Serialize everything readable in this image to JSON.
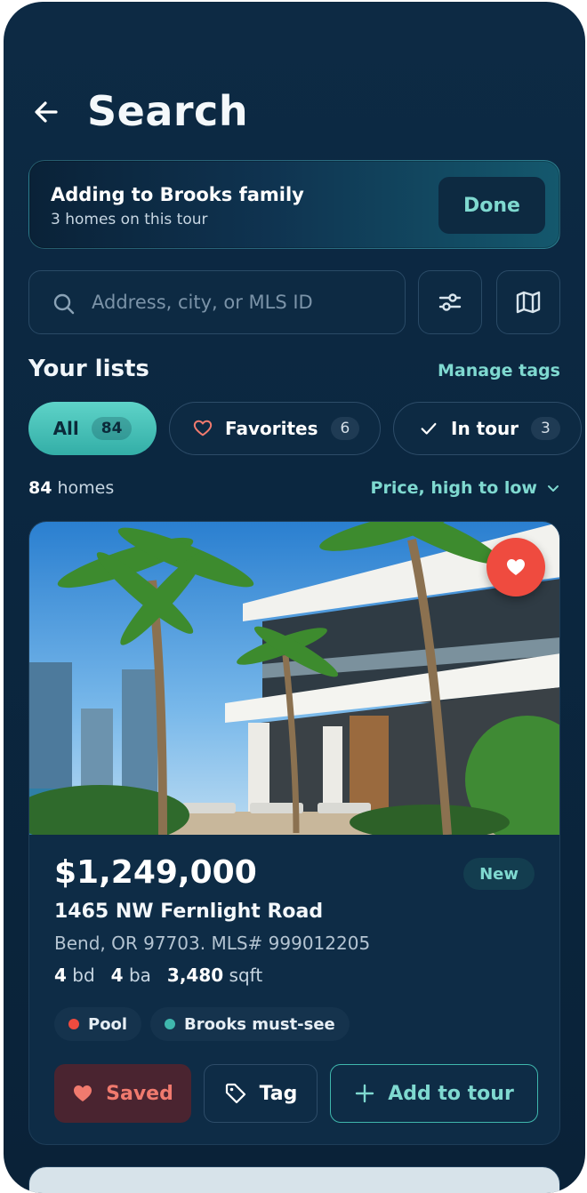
{
  "header": {
    "title": "Search",
    "back_icon": "arrow-left-icon"
  },
  "tour_banner": {
    "title": "Adding to Brooks family",
    "subtitle": "3 homes on this tour",
    "done_label": "Done"
  },
  "search": {
    "placeholder": "Address, city, or MLS ID",
    "value": "",
    "search_icon": "search-icon",
    "filter_icon": "sliders-icon",
    "map_icon": "map-icon"
  },
  "lists": {
    "title": "Your lists",
    "manage_label": "Manage tags",
    "chips": [
      {
        "label": "All",
        "count": "84",
        "selected": true
      },
      {
        "label": "Favorites",
        "count": "6",
        "icon": "heart-outline-icon"
      },
      {
        "label": "In tour",
        "count": "3",
        "icon": "check-icon"
      }
    ]
  },
  "results": {
    "count_number": "84",
    "count_label": "homes",
    "sort_label": "Price, high to low"
  },
  "listing": {
    "price": "$1,249,000",
    "badge": "New",
    "address": "1465 NW Fernlight Road",
    "city_mls": "Bend, OR 97703. MLS# 999012205",
    "beds": "4",
    "beds_label": "bd",
    "baths": "4",
    "baths_label": "ba",
    "sqft": "3,480",
    "sqft_label": "sqft",
    "tags": [
      {
        "label": "Pool",
        "color": "#ef4b3f"
      },
      {
        "label": "Brooks must-see",
        "color": "#3fb7ad"
      }
    ],
    "actions": {
      "saved_label": "Saved",
      "tag_label": "Tag",
      "add_label": "Add to tour"
    },
    "favorited": true
  },
  "colors": {
    "accent": "#7fd9d0",
    "background": "#0b2740",
    "favorite_red": "#ef4b3f"
  }
}
